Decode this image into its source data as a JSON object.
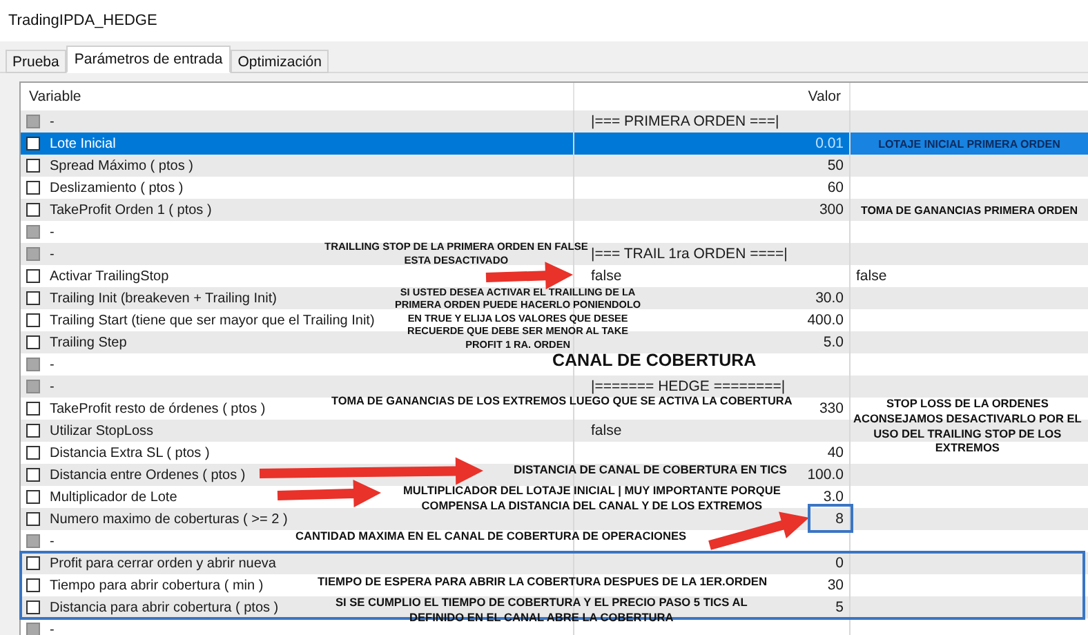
{
  "window": {
    "title": "TradingIPDA_HEDGE"
  },
  "tabs": [
    {
      "label": "Prueba",
      "selected": false
    },
    {
      "label": "Parámetros de entrada",
      "selected": true
    },
    {
      "label": "Optimización",
      "selected": false
    }
  ],
  "table": {
    "columns": [
      "Variable",
      "Valor"
    ],
    "rows": [
      {
        "kind": "section",
        "variable": "-",
        "value": "|=== PRIMERA ORDEN ===|",
        "checked": false,
        "disabled": true,
        "selected": false
      },
      {
        "kind": "number",
        "variable": "Lote Inicial",
        "value": "0.01",
        "checked": false,
        "disabled": false,
        "selected": true,
        "note": "LOTAJE INICIAL PRIMERA ORDEN"
      },
      {
        "kind": "number",
        "variable": "Spread Máximo ( ptos )",
        "value": "50",
        "checked": false,
        "disabled": false,
        "selected": false
      },
      {
        "kind": "number",
        "variable": "Deslizamiento ( ptos )",
        "value": "60",
        "checked": false,
        "disabled": false,
        "selected": false
      },
      {
        "kind": "number",
        "variable": "TakeProfit Orden 1 ( ptos )",
        "value": "300",
        "checked": false,
        "disabled": false,
        "selected": false,
        "note": "TOMA DE GANANCIAS PRIMERA ORDEN"
      },
      {
        "kind": "section",
        "variable": "-",
        "checked": false,
        "disabled": true,
        "selected": false
      },
      {
        "kind": "section",
        "variable": "-",
        "value": "|=== TRAIL 1ra ORDEN ====|",
        "checked": false,
        "disabled": true,
        "selected": false
      },
      {
        "kind": "bool",
        "variable": "Activar TrailingStop",
        "value": "false",
        "column_3": "false",
        "checked": false,
        "disabled": false,
        "selected": false
      },
      {
        "kind": "number",
        "variable": "Trailing Init (breakeven + Trailing Init)",
        "value": "30.0",
        "checked": false,
        "disabled": false,
        "selected": false
      },
      {
        "kind": "number",
        "variable": "Trailing Start (tiene que ser mayor que el Trailing Init)",
        "value": "400.0",
        "checked": false,
        "disabled": false,
        "selected": false
      },
      {
        "kind": "number",
        "variable": "Trailing Step",
        "value": "5.0",
        "checked": false,
        "disabled": false,
        "selected": false
      },
      {
        "kind": "section",
        "variable": "-",
        "checked": false,
        "disabled": true,
        "selected": false
      },
      {
        "kind": "section",
        "variable": "-",
        "value": "|======= HEDGE ========|",
        "checked": false,
        "disabled": true,
        "selected": false
      },
      {
        "kind": "number",
        "variable": "TakeProfit resto de órdenes ( ptos )",
        "value": "330",
        "checked": false,
        "disabled": false,
        "selected": false
      },
      {
        "kind": "bool",
        "variable": "Utilizar StopLoss",
        "value": "false",
        "checked": false,
        "disabled": false,
        "selected": false
      },
      {
        "kind": "number",
        "variable": "Distancia Extra SL ( ptos )",
        "value": "40",
        "checked": false,
        "disabled": false,
        "selected": false
      },
      {
        "kind": "number",
        "variable": "Distancia entre Ordenes ( ptos )",
        "value": "100.0",
        "checked": false,
        "disabled": false,
        "selected": false
      },
      {
        "kind": "number",
        "variable": "Multiplicador de Lote",
        "value": "3.0",
        "checked": false,
        "disabled": false,
        "selected": false
      },
      {
        "kind": "number",
        "variable": "Numero maximo de coberturas ( >= 2 )",
        "value": "8",
        "checked": false,
        "disabled": false,
        "selected": false
      },
      {
        "kind": "section",
        "variable": "-",
        "checked": false,
        "disabled": true,
        "selected": false
      },
      {
        "kind": "number",
        "variable": "Profit para cerrar orden y abrir nueva",
        "value": "0",
        "checked": false,
        "disabled": false,
        "selected": false
      },
      {
        "kind": "number",
        "variable": "Tiempo para abrir cobertura ( min )",
        "value": "30",
        "checked": false,
        "disabled": false,
        "selected": false
      },
      {
        "kind": "number",
        "variable": "Distancia para abrir cobertura ( ptos )",
        "value": "5",
        "checked": false,
        "disabled": false,
        "selected": false
      },
      {
        "kind": "section",
        "variable": "-",
        "checked": false,
        "disabled": true,
        "selected": false
      }
    ]
  },
  "annotations": [
    {
      "lines": [
        "TRAILLING STOP DE LA PRIMERA ORDEN EN FALSE",
        "ESTA DESACTIVADO"
      ]
    },
    {
      "lines": [
        "SI USTED DESEA ACTIVAR EL TRAILLING DE LA",
        "PRIMERA ORDEN PUEDE HACERLO PONIENDOLO",
        "EN TRUE Y ELIJA LOS VALORES QUE DESEE",
        "RECUERDE QUE DEBE SER MENOR AL TAKE",
        "PROFIT 1 RA. ORDEN"
      ]
    },
    {
      "lines": [
        "CANAL DE COBERTURA"
      ]
    },
    {
      "lines": [
        "TOMA DE GANANCIAS DE LOS EXTREMOS LUEGO QUE SE ACTIVA LA COBERTURA"
      ]
    },
    {
      "lines": [
        "STOP LOSS DE LA ORDENES",
        "ACONSEJAMOS DESACTIVARLO POR EL",
        "USO DEL TRAILING STOP DE LOS",
        "EXTREMOS"
      ]
    },
    {
      "lines": [
        "DISTANCIA DE CANAL DE COBERTURA EN TICS"
      ]
    },
    {
      "lines": [
        "MULTIPLICADOR DEL LOTAJE INICIAL | MUY IMPORTANTE PORQUE",
        "COMPENSA LA DISTANCIA DEL CANAL Y DE LOS EXTREMOS"
      ]
    },
    {
      "lines": [
        "CANTIDAD MAXIMA EN EL CANAL DE COBERTURA DE OPERACIONES"
      ]
    },
    {
      "lines": [
        "TIEMPO DE ESPERA PARA ABRIR LA COBERTURA DESPUES DE LA 1ER.ORDEN"
      ]
    },
    {
      "lines": [
        "SI SE CUMPLIO EL TIEMPO DE COBERTURA Y EL PRECIO PASO 5 TICS AL",
        "DEFINIDO EN EL CANAL ABRE LA COBERTURA"
      ]
    }
  ]
}
